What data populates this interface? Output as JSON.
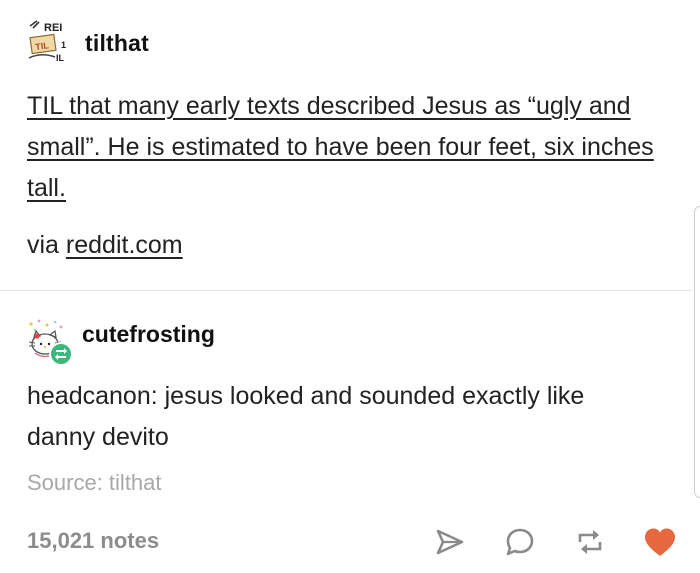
{
  "post": {
    "username": "tilthat",
    "title": "TIL that many early texts described Jesus as “ugly and small”. He is estimated to have been four feet, six inches tall.",
    "via_prefix": "via",
    "via_link": "reddit.com",
    "avatar_text_1": "REI",
    "avatar_text_2": "TIL",
    "avatar_text_3": "1",
    "avatar_text_4": "IL",
    "avatar_icon": "til-logo-icon"
  },
  "reblog": {
    "username": "cutefrosting",
    "body": "headcanon: jesus looked and sounded exactly like danny devito",
    "source": "Source: tilthat",
    "avatar_icon": "hello-kitty-avatar-icon",
    "badge_icon": "reblog-badge-icon"
  },
  "footer": {
    "notes": "15,021 notes",
    "icons": [
      "share-icon",
      "reply-icon",
      "reblog-icon",
      "like-heart-icon"
    ]
  },
  "colors": {
    "heart": "#e5683f",
    "reblog_badge": "#3db87a",
    "icon_gray": "#8a8a8a",
    "source_gray": "#a8a8a8"
  }
}
